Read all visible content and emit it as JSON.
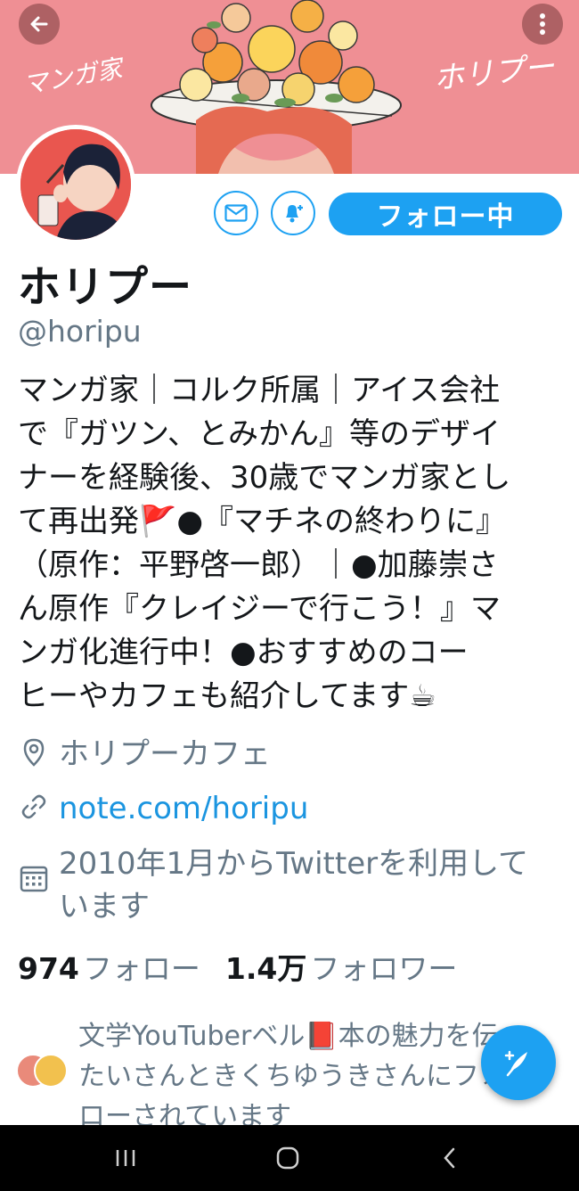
{
  "banner": {
    "left_text": "マンガ家",
    "right_text": "ホリプー",
    "background_color": "#ef8f94"
  },
  "header": {
    "back_icon": "arrow-left-icon",
    "more_icon": "more-vertical-icon"
  },
  "actions": {
    "message_icon": "envelope-icon",
    "notify_icon": "bell-plus-icon",
    "follow_label": "フォロー中",
    "accent_color": "#1da1f2"
  },
  "profile": {
    "name": "ホリプー",
    "handle": "@horipu",
    "bio_lines": [
      "マンガ家｜コルク所属｜アイス会社",
      "で『ガツン、とみかん』等のデザイ",
      "ナーを経験後、30歳でマンガ家とし",
      "て再出発🚩●『マチネの終わりに』",
      "（原作：平野啓一郎）｜●加藤崇さ",
      "ん原作『クレイジーで行こう！』マ",
      "ンガ化進行中！●おすすめのコー",
      "ヒーやカフェも紹介してます☕"
    ],
    "location": "ホリプーカフェ",
    "url": "note.com/horipu",
    "joined_lines": [
      "2010年1月からTwitterを利用して",
      "います"
    ]
  },
  "stats": {
    "following_count": "974",
    "following_label": "フォロー",
    "followers_count": "1.4万",
    "followers_label": "フォロワー"
  },
  "followed_by": {
    "lines": [
      "文学YouTuberベル📕本の魅力を伝え",
      "たいさんときくちゆうきさんにフォ",
      "ローされています"
    ]
  },
  "fab": {
    "icon": "compose-feather-icon"
  },
  "system_nav": {
    "recent_icon": "recent-apps-icon",
    "home_icon": "home-circle-icon",
    "back_icon": "chevron-left-icon"
  }
}
